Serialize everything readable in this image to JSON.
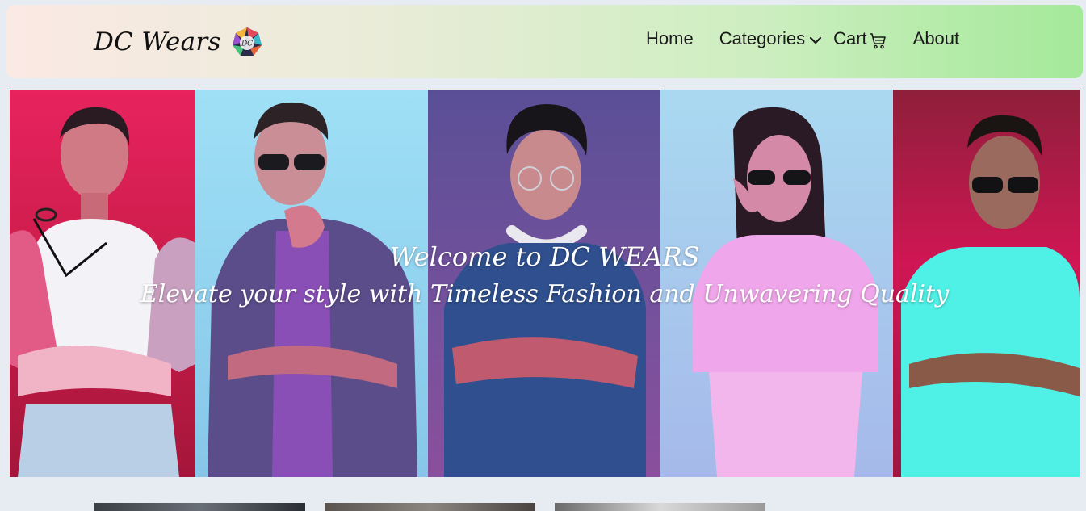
{
  "brand": {
    "name": "DC Wears",
    "logo_text": "DC"
  },
  "nav": {
    "home": "Home",
    "categories": "Categories",
    "cart": "Cart",
    "about": "About"
  },
  "hero": {
    "title": "Welcome to DC WEARS",
    "subtitle": "Elevate your style with Timeless Fashion and Unwavering Quality"
  },
  "colors": {
    "nav_gradient_start": "#fbe9e4",
    "nav_gradient_end": "#a4e99a",
    "page_bg": "#e6ecf1",
    "hero_text": "#ffffff"
  },
  "icons": [
    "chevron-down-icon",
    "cart-icon"
  ]
}
